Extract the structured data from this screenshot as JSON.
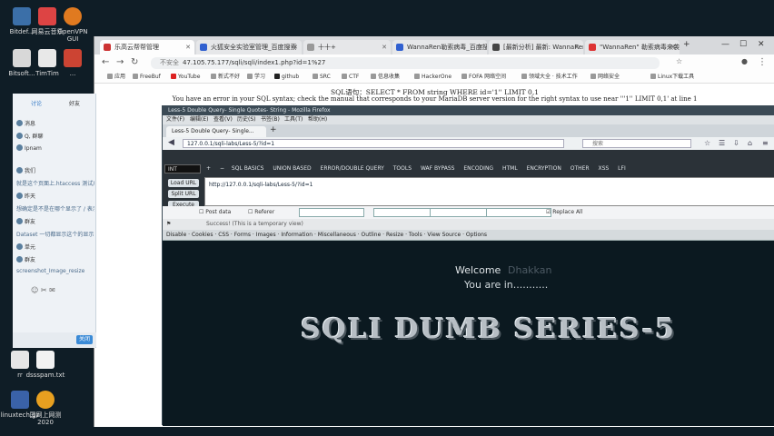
{
  "desktop_icons": [
    {
      "label": "Bitdef..."
    },
    {
      "label": "网易云音乐"
    },
    {
      "label": "OpenVPN GUI"
    },
    {
      "label": "Bitsoft..."
    },
    {
      "label": "TimTim"
    },
    {
      "label": "..."
    },
    {
      "label": "rr"
    },
    {
      "label": "Bitsoft..."
    },
    {
      "label": "..."
    }
  ],
  "desktop_bottom": [
    {
      "label": "rr"
    },
    {
      "label": "dssspam.txt"
    },
    {
      "label": "linuxtech.gz"
    },
    {
      "label": "国网上网测 2020"
    }
  ],
  "outer_browser": {
    "tabs": [
      {
        "label": "乐高云帮帮管理"
      },
      {
        "label": "火狐安全实验室管理_百度搜索"
      },
      {
        "label": "十十+"
      },
      {
        "label": "WannaRen勒索病毒_百度搜索"
      },
      {
        "label": "[最新分析] 最新: WannaRen"
      },
      {
        "label": "\"WannaRen\" 勒索病毒来袭..."
      }
    ],
    "url": "47.105.75.177/sqli/sqli/index1.php?id=1%27",
    "url_prefix": "不安全",
    "bookmarks": [
      "应用",
      "FreeBuf",
      "YouTube",
      "新式不好",
      "学习",
      "github",
      "SRC",
      "CTF",
      "信息收集",
      "HackerOne",
      "FOFA 网络空间",
      "领域大全 · 技术工作",
      "网络安全",
      "Linux下载工具"
    ],
    "sql_line": "SQL语句：SELECT * FROM string WHERE id='1'' LIMIT 0,1",
    "error_line": "You have an error in your SQL syntax; check the manual that corresponds to your MariaDB server version for the right syntax to use near '''1'' LIMIT 0,1' at line 1"
  },
  "qq_panel": {
    "header_a": "讨论",
    "header_b": "好友",
    "items": [
      "消息",
      "Q, 群聊",
      "Ipnam",
      "我们",
      "就是这个页面上.htaccess 测试成功了",
      "昨天",
      "想确定是不是在哪个显示了 / 表示不可用",
      "群友",
      "Dataset 一切都显示这个的显示了",
      "单元",
      "群友",
      "screenshot_Image_resize"
    ],
    "close_label": "关闭"
  },
  "inner_browser": {
    "title": "Less-5 Double Query- Single Quotes- String - Mozilla Firefox",
    "menu": [
      "文件(F)",
      "编辑(E)",
      "查看(V)",
      "历史(S)",
      "书签(B)",
      "工具(T)",
      "帮助(H)"
    ],
    "tab_label": "Less-5 Double Query- Single...",
    "url": "127.0.0.1/sqli-labs/Less-5/?id=1",
    "search_placeholder": "搜索",
    "hackbar_select": "INT",
    "hackbar_menu": [
      "SQL BASICS",
      "UNION BASED",
      "ERROR/DOUBLE QUERY",
      "TOOLS",
      "WAF BYPASS",
      "ENCODING",
      "HTML",
      "ENCRYPTION",
      "OTHER",
      "XSS",
      "LFI"
    ],
    "load_url": "Load URL",
    "split_url": "Split URL",
    "execute": "Execute",
    "hackbar_input": "http://127.0.0.1/sqli-labs/Less-5/?id=1",
    "post_data": "Post data",
    "referer": "Referer",
    "replace_all": "Replace All",
    "status_note": "Success! (This is a temporary view)",
    "toolbar": "Disable · Cookies · CSS · Forms · Images · Information · Miscellaneous · Outline · Resize · Tools · View Source · Options"
  },
  "page": {
    "welcome": "Welcome",
    "welcome_name": "Dhakkan",
    "you_are_in": "You are in...........",
    "title": "SQLI DUMB SERIES-5"
  }
}
